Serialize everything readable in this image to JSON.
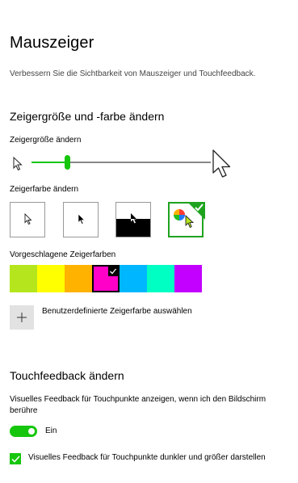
{
  "page": {
    "title": "Mauszeiger",
    "description": "Verbessern Sie die Sichtbarkeit von Mauszeiger und Touchfeedback."
  },
  "pointer_section": {
    "heading": "Zeigergröße und -farbe ändern",
    "size_label": "Zeigergröße ändern",
    "size_level": 0.2,
    "color_label": "Zeigerfarbe ändern",
    "color_options": [
      "white",
      "black",
      "inverted",
      "custom"
    ],
    "selected_color_option": "custom",
    "suggested_label": "Vorgeschlagene Zeigerfarben",
    "suggested_colors": [
      "#b5e61d",
      "#ffff00",
      "#ffb200",
      "#ff00c8",
      "#00b7ff",
      "#00ffc3",
      "#c300ff"
    ],
    "selected_suggested_index": 3,
    "custom_color_label": "Benutzerdefinierte Zeigerfarbe auswählen",
    "accent": "#16c60c"
  },
  "touch_section": {
    "heading": "Touchfeedback ändern",
    "feedback_label": "Visuelles Feedback für Touchpunkte anzeigen, wenn ich den Bildschirm berühre",
    "toggle_state": "Ein",
    "darker_label": "Visuelles Feedback für Touchpunkte dunkler und größer darstellen",
    "darker_checked": true
  }
}
